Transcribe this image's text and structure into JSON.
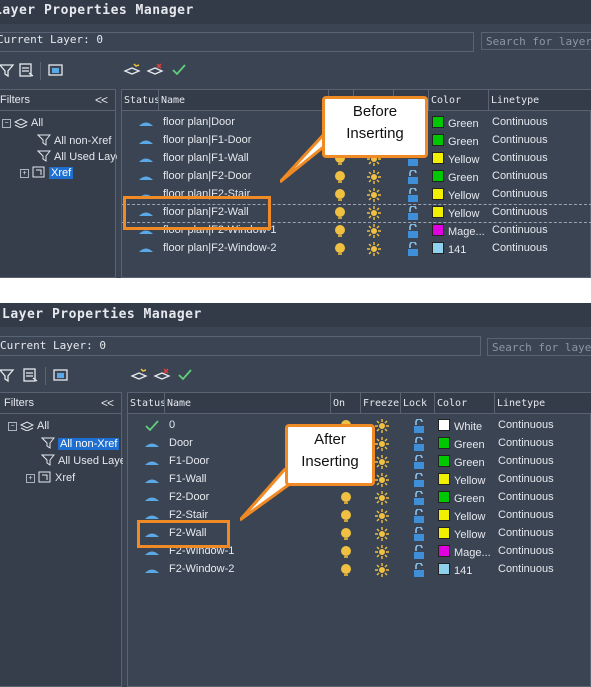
{
  "before": {
    "title": "Layer Properties Manager",
    "current_layer": "Current Layer: 0",
    "search_placeholder": "Search for layer",
    "filters_label": "Filters",
    "filters_collapse": "<<",
    "tree": [
      "All",
      "All non-Xref",
      "All Used Layers",
      "Xref"
    ],
    "headers": [
      "Status",
      "Name",
      "",
      "",
      "",
      "Color",
      "Linetype"
    ],
    "rows": [
      {
        "name": "floor plan|Door",
        "color": "Green",
        "swatch": "#00c800",
        "linetype": "Continuous"
      },
      {
        "name": "floor plan|F1-Door",
        "color": "Green",
        "swatch": "#00c800",
        "linetype": "Continuous"
      },
      {
        "name": "floor plan|F1-Wall",
        "color": "Yellow",
        "swatch": "#f0f000",
        "linetype": "Continuous"
      },
      {
        "name": "floor plan|F2-Door",
        "color": "Green",
        "swatch": "#00c800",
        "linetype": "Continuous"
      },
      {
        "name": "floor plan|F2-Stair",
        "color": "Yellow",
        "swatch": "#f0f000",
        "linetype": "Continuous"
      },
      {
        "name": "floor plan|F2-Wall",
        "color": "Yellow",
        "swatch": "#f0f000",
        "linetype": "Continuous"
      },
      {
        "name": "floor plan|F2-Window-1",
        "color": "Mage...",
        "swatch": "#e000e0",
        "linetype": "Continuous"
      },
      {
        "name": "floor plan|F2-Window-2",
        "color": "141",
        "swatch": "#8ed2ee",
        "linetype": "Continuous"
      }
    ],
    "callout_line1": "Before",
    "callout_line2": "Inserting"
  },
  "after": {
    "title": "Layer Properties Manager",
    "current_layer": "Current Layer: 0",
    "search_placeholder": "Search for layer",
    "filters_label": "Filters",
    "filters_collapse": "<<",
    "tree": [
      "All",
      "All non-Xref",
      "All Used Layers",
      "Xref"
    ],
    "headers": [
      "Status",
      "Name",
      "On",
      "Freeze",
      "Lock",
      "Color",
      "Linetype"
    ],
    "rows": [
      {
        "name": "0",
        "color": "White",
        "swatch": "#ffffff",
        "linetype": "Continuous",
        "current": true
      },
      {
        "name": "Door",
        "color": "Green",
        "swatch": "#00c800",
        "linetype": "Continuous"
      },
      {
        "name": "F1-Door",
        "color": "Green",
        "swatch": "#00c800",
        "linetype": "Continuous"
      },
      {
        "name": "F1-Wall",
        "color": "Yellow",
        "swatch": "#f0f000",
        "linetype": "Continuous"
      },
      {
        "name": "F2-Door",
        "color": "Green",
        "swatch": "#00c800",
        "linetype": "Continuous"
      },
      {
        "name": "F2-Stair",
        "color": "Yellow",
        "swatch": "#f0f000",
        "linetype": "Continuous"
      },
      {
        "name": "F2-Wall",
        "color": "Yellow",
        "swatch": "#f0f000",
        "linetype": "Continuous"
      },
      {
        "name": "F2-Window-1",
        "color": "Mage...",
        "swatch": "#e000e0",
        "linetype": "Continuous"
      },
      {
        "name": "F2-Window-2",
        "color": "141",
        "swatch": "#8ed2ee",
        "linetype": "Continuous"
      }
    ],
    "callout_line1": "After",
    "callout_line2": "Inserting"
  },
  "accent": "#f08a24",
  "icons": {
    "status": "layer-status-icon",
    "on": "lightbulb-icon",
    "freeze": "sun-icon",
    "lock": "unlocked-padlock-icon",
    "current": "checkmark-icon"
  }
}
